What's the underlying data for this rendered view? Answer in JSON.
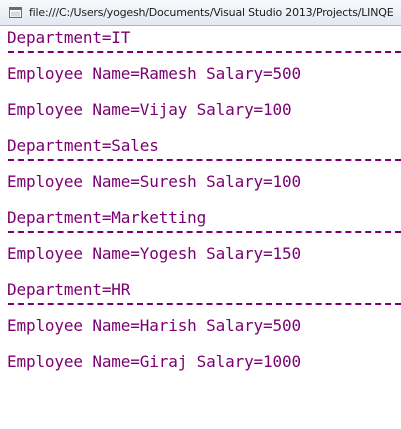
{
  "window": {
    "title": "file:///C:/Users/yogesh/Documents/Visual Studio 2013/Projects/LINQE",
    "icon": "console-window-icon"
  },
  "console": {
    "text_color": "#7a0071",
    "lines": [
      "Department=IT",
      "Employee Name=Ramesh Salary=500",
      "Employee Name=Vijay Salary=100",
      "Department=Sales",
      "Employee Name=Suresh Salary=100",
      "Department=Marketting",
      "Employee Name=Yogesh Salary=150",
      "Department=HR",
      "Employee Name=Harish Salary=500",
      "Employee Name=Giraj Salary=1000"
    ]
  }
}
